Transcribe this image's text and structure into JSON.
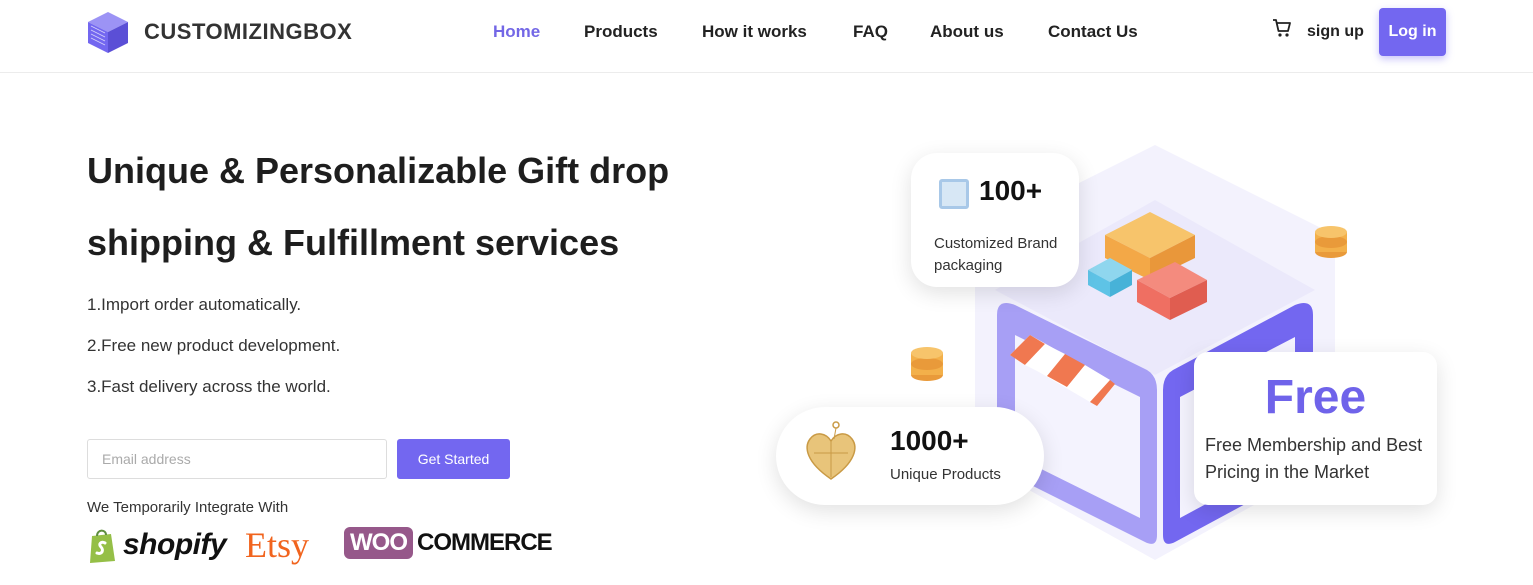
{
  "brand": {
    "name": "CUSTOMIZINGBOX"
  },
  "nav": {
    "items": [
      {
        "label": "Home",
        "active": true
      },
      {
        "label": "Products",
        "active": false
      },
      {
        "label": "How it works",
        "active": false
      },
      {
        "label": "FAQ",
        "active": false
      },
      {
        "label": "About us",
        "active": false
      },
      {
        "label": "Contact Us",
        "active": false
      }
    ],
    "cart_icon": "cart-icon",
    "signup_label": "sign up",
    "login_label": "Log in"
  },
  "hero": {
    "headline": "Unique & Personalizable Gift drop shipping & Fulfillment services",
    "bullets": [
      "1.Import order automatically.",
      "2.Free new product development.",
      "3.Fast delivery across the world."
    ],
    "email_placeholder": "Email address",
    "email_value": "",
    "cta_label": "Get Started",
    "integrate_text": "We Temporarily Integrate With",
    "integrations": {
      "shopify": "shopify",
      "etsy": "Etsy",
      "woo": "WOO",
      "commerce": "COMMERCE"
    }
  },
  "illustration": {
    "brand_card": {
      "value": "100+",
      "label": "Customized Brand packaging"
    },
    "products_card": {
      "value": "1000+",
      "label": "Unique Products"
    },
    "free_card": {
      "value": "Free",
      "label": "Free Membership and Best Pricing in the Market"
    }
  },
  "colors": {
    "accent": "#7367f0",
    "active_nav": "#7367e6",
    "etsy": "#f1641e",
    "woo": "#96588a",
    "shopify_green": "#95bf47"
  }
}
